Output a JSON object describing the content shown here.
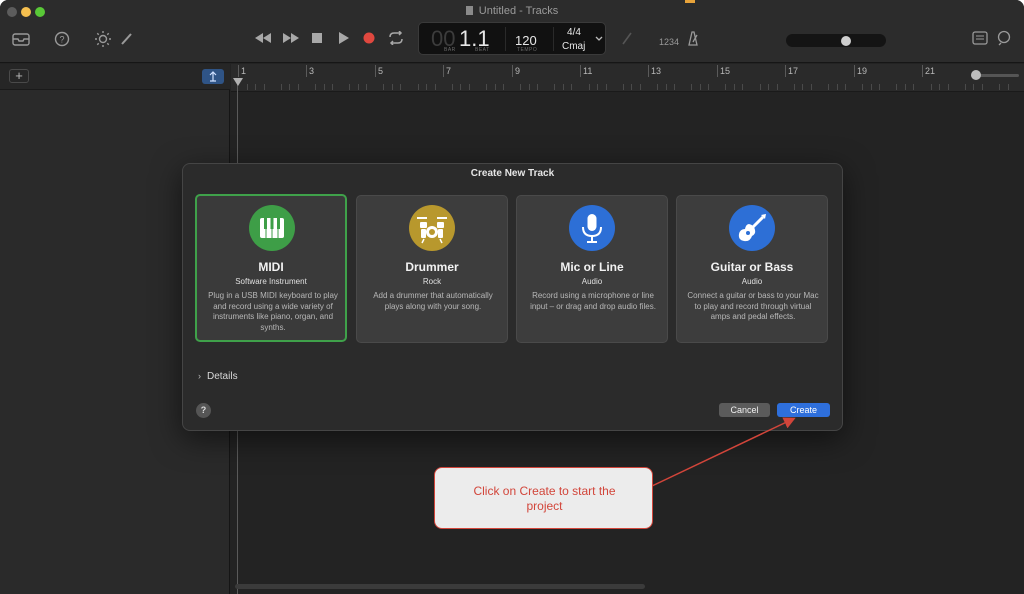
{
  "window": {
    "title": "Untitled - Tracks"
  },
  "toolbar": {
    "icons": [
      "library-icon",
      "help-icon",
      "smart-controls-icon",
      "editors-icon",
      "rewind-icon",
      "forward-icon",
      "stop-icon",
      "play-icon",
      "record-icon",
      "cycle-icon",
      "tuner-icon",
      "count-in-icon",
      "metronome-icon",
      "notepad-icon",
      "loop-browser-icon"
    ],
    "count_in_label": "1234"
  },
  "lcd": {
    "bar_ghost": "00",
    "position": "1.1",
    "bar_label": "BAR",
    "beat_label": "BEAT",
    "tempo": "120",
    "tempo_label": "TEMPO",
    "signature": "4/4",
    "key": "Cmaj"
  },
  "volume": {
    "level": 0.62
  },
  "ruler": {
    "bars": [
      "1",
      "3",
      "5",
      "7",
      "9",
      "11",
      "13",
      "15",
      "17",
      "19",
      "21"
    ]
  },
  "dialog": {
    "title": "Create New Track",
    "cards": [
      {
        "title": "MIDI",
        "subtitle": "Software Instrument",
        "description": "Plug in a USB MIDI keyboard to play and record using a wide variety of instruments like piano, organ, and synths.",
        "icon": "piano-keys-icon",
        "color": "#3e9e47",
        "selected": true
      },
      {
        "title": "Drummer",
        "subtitle": "Rock",
        "description": "Add a drummer that automatically plays along with your song.",
        "icon": "drum-kit-icon",
        "color": "#b8982d",
        "selected": false
      },
      {
        "title": "Mic or Line",
        "subtitle": "Audio",
        "description": "Record using a microphone or line input – or drag and drop audio files.",
        "icon": "microphone-icon",
        "color": "#2d6fd6",
        "selected": false
      },
      {
        "title": "Guitar or Bass",
        "subtitle": "Audio",
        "description": "Connect a guitar or bass to your Mac to play and record through virtual amps and pedal effects.",
        "icon": "guitar-icon",
        "color": "#2d6fd6",
        "selected": false
      }
    ],
    "details_label": "Details",
    "help_label": "?",
    "cancel_label": "Cancel",
    "create_label": "Create"
  },
  "annotation": {
    "text": "Click on Create to start the project",
    "color": "#d2453a"
  },
  "colors": {
    "accent": "#2e6fdc",
    "selected_border": "#3fa14a",
    "record": "#e0483f"
  }
}
